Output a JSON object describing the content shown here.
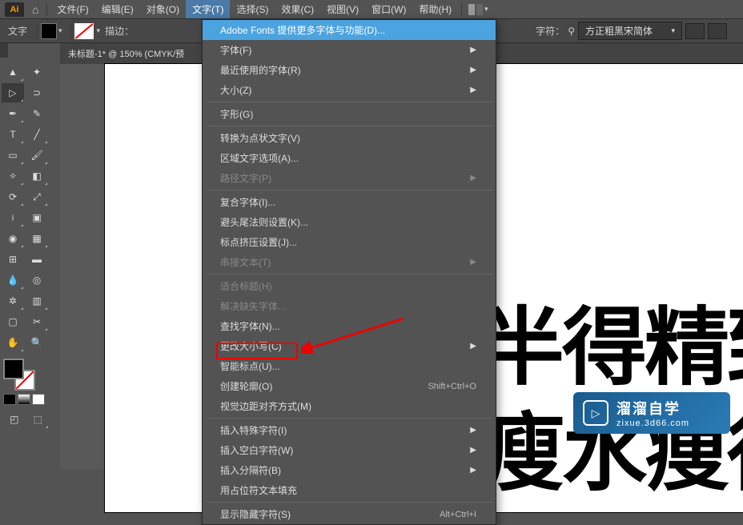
{
  "app": {
    "logo": "Ai"
  },
  "menubar": {
    "items": [
      {
        "label": "文件(F)"
      },
      {
        "label": "编辑(E)"
      },
      {
        "label": "对象(O)"
      },
      {
        "label": "文字(T)",
        "active": true
      },
      {
        "label": "选择(S)"
      },
      {
        "label": "效果(C)"
      },
      {
        "label": "视图(V)"
      },
      {
        "label": "窗口(W)"
      },
      {
        "label": "帮助(H)"
      }
    ]
  },
  "options": {
    "label": "文字",
    "stroke_label": "描边：",
    "char_label": "字符：",
    "font_name": "方正粗黑宋简体"
  },
  "doc": {
    "tab": "未标题-1* @ 150% (CMYK/预"
  },
  "canvas": {
    "text1": "半得精致",
    "text2": "瘦水痩得雷"
  },
  "dropdown": {
    "items": [
      {
        "label": "Adobe Fonts 提供更多字体与功能(D)...",
        "hl": true
      },
      {
        "label": "字体(F)",
        "sub": true
      },
      {
        "label": "最近使用的字体(R)",
        "sub": true
      },
      {
        "label": "大小(Z)",
        "sub": true
      },
      {
        "sep": true
      },
      {
        "label": "字形(G)"
      },
      {
        "sep": true
      },
      {
        "label": "转换为点状文字(V)"
      },
      {
        "label": "区域文字选项(A)..."
      },
      {
        "label": "路径文字(P)",
        "sub": true,
        "disabled": true
      },
      {
        "sep": true
      },
      {
        "label": "复合字体(I)..."
      },
      {
        "label": "避头尾法则设置(K)..."
      },
      {
        "label": "标点挤压设置(J)..."
      },
      {
        "label": "串接文本(T)",
        "sub": true,
        "disabled": true
      },
      {
        "sep": true
      },
      {
        "label": "适合标题(H)",
        "disabled": true
      },
      {
        "label": "解决缺失字体...",
        "disabled": true
      },
      {
        "label": "查找字体(N)..."
      },
      {
        "label": "更改大小写(C)",
        "sub": true
      },
      {
        "label": "智能标点(U)..."
      },
      {
        "label": "创建轮廓(O)",
        "shortcut": "Shift+Ctrl+O"
      },
      {
        "label": "视觉边距对齐方式(M)"
      },
      {
        "sep": true
      },
      {
        "label": "插入特殊字符(I)",
        "sub": true
      },
      {
        "label": "插入空白字符(W)",
        "sub": true
      },
      {
        "label": "插入分隔符(B)",
        "sub": true
      },
      {
        "label": "用占位符文本填充"
      },
      {
        "sep": true
      },
      {
        "label": "显示隐藏字符(S)",
        "shortcut": "Alt+Ctrl+I"
      }
    ]
  },
  "watermark": {
    "title": "溜溜自学",
    "url": "zixue.3d66.com"
  }
}
